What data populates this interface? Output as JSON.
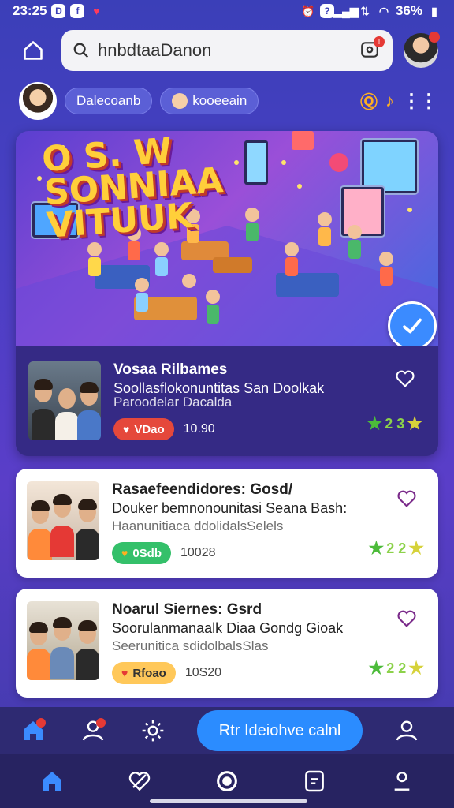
{
  "status_bar": {
    "time": "23:25",
    "battery": "36%"
  },
  "search": {
    "value": "hnbdtaaDanon"
  },
  "chips": {
    "chip1_label": "Dalecoanb",
    "chip2_label": "kooeeain"
  },
  "hero": {
    "banner_title_line1": "O S. W",
    "banner_title_line2": "SONNIAA",
    "banner_title_line3": "VITUUK",
    "item_title": "Vosaa Rilbames",
    "item_subtitle": "Soollasflokonuntitas San Doolkak",
    "item_subtitle2": "Paroodelar Dacalda",
    "pill_label": "VDao",
    "count": "10.90",
    "rating": "2 3"
  },
  "cards": [
    {
      "title": "Rasaefeendidores: Gosd/",
      "subtitle": "Douker bemnonounitasi Seana Bash:",
      "subtitle2": "Haanunitiaca ddolidalsSelels",
      "pill_label": "0Sdb",
      "count": "10028",
      "rating": "2 2"
    },
    {
      "title": "Noarul Siernes: Gsrd",
      "subtitle": "Soorulanmanaalk Diaa Gondg Gioak",
      "subtitle2": "Seerunitica sdidolbalsSlas",
      "pill_label": "Rfoao",
      "count": "10S20",
      "rating": "2 2"
    }
  ],
  "nav": {
    "cta_label": "Rtr Ideiohve calnl"
  },
  "colors": {
    "accent": "#2b8cff",
    "background": "#4a3fc4",
    "badge_red": "#e53935"
  }
}
